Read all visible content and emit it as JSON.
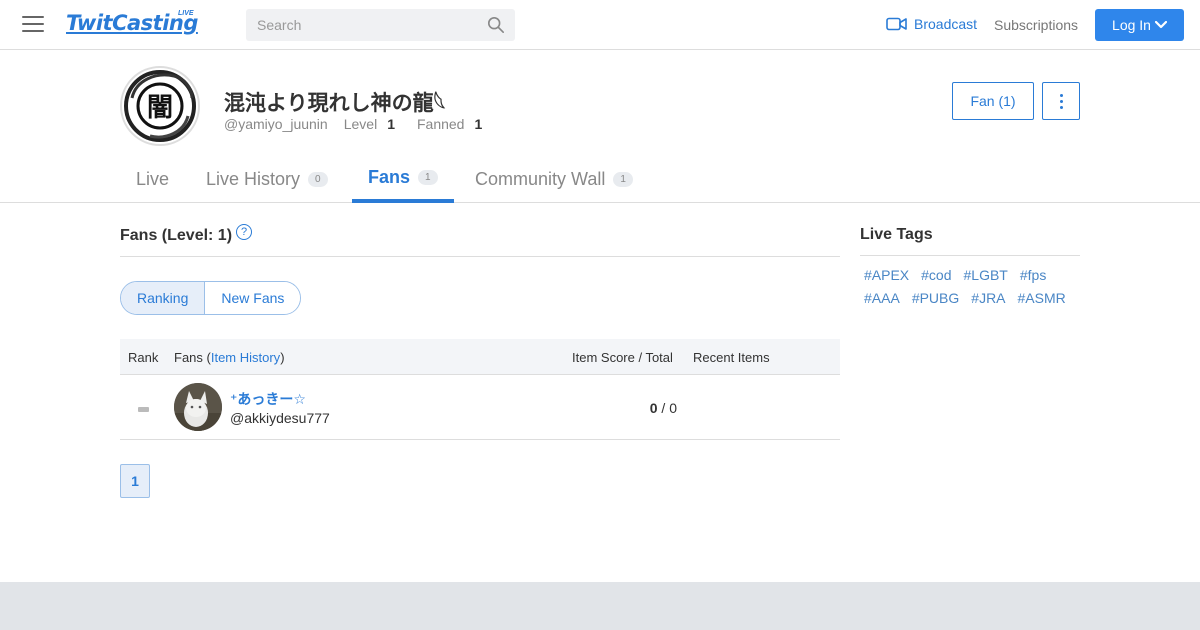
{
  "header": {
    "logo_text": "TwitCasting",
    "logo_badge": "LIVE",
    "search_placeholder": "Search",
    "broadcast_label": "Broadcast",
    "subscriptions_label": "Subscriptions",
    "login_label": "Log In"
  },
  "profile": {
    "name": "混沌より現れし神の龍𓆩",
    "handle": "@yamiyo_juunin",
    "level_label": "Level",
    "level_value": "1",
    "fanned_label": "Fanned",
    "fanned_value": "1",
    "avatar_glyph": "闇",
    "fan_button_label": "Fan (1)"
  },
  "tabs": [
    {
      "label": "Live",
      "badge": ""
    },
    {
      "label": "Live History",
      "badge": "0"
    },
    {
      "label": "Fans",
      "badge": "1",
      "active": true
    },
    {
      "label": "Community Wall",
      "badge": "1"
    }
  ],
  "fans_section": {
    "title": "Fans (Level: 1)",
    "help_glyph": "?",
    "toggle": [
      {
        "label": "Ranking",
        "active": true
      },
      {
        "label": "New Fans",
        "active": false
      }
    ],
    "columns": {
      "rank": "Rank",
      "fans_prefix": "Fans (",
      "fans_link": "Item History",
      "fans_suffix": ")",
      "score": "Item Score / Total",
      "recent": "Recent Items"
    },
    "rows": [
      {
        "name": "⁺あっきー☆",
        "handle": "@akkiydesu777",
        "score": "0",
        "total": "0",
        "score_sep": " / "
      }
    ],
    "pagination": [
      "1"
    ]
  },
  "sidebar": {
    "title": "Live Tags",
    "tags": [
      "#APEX",
      "#cod",
      "#LGBT",
      "#fps",
      "#AAA",
      "#PUBG",
      "#JRA",
      "#ASMR"
    ]
  },
  "colors": {
    "accent": "#2a7bd6",
    "login_bg": "#2f86eb",
    "footer_bg": "#e1e4e8"
  }
}
